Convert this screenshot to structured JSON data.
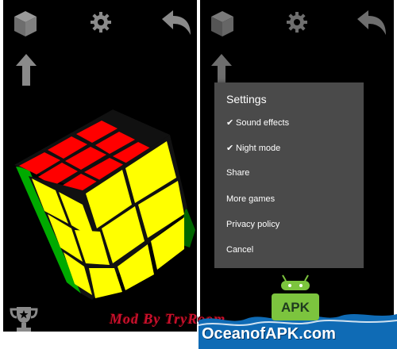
{
  "settings_menu": {
    "title": "Settings",
    "items": [
      {
        "label": "Sound effects",
        "checked": true
      },
      {
        "label": "Night mode",
        "checked": true
      },
      {
        "label": "Share",
        "checked": false
      },
      {
        "label": "More games",
        "checked": false
      },
      {
        "label": "Privacy policy",
        "checked": false
      },
      {
        "label": "Cancel",
        "checked": false
      }
    ],
    "check_mark": "✔"
  },
  "watermark": {
    "text": "Mod By TryRoom"
  },
  "brand": {
    "name": "OceanofAPK.com",
    "badge_text": "APK"
  },
  "colors": {
    "background": "#000000",
    "icon_gray": "#8a8a8a",
    "cube_red": "#ff0000",
    "cube_yellow": "#ffff00",
    "cube_green": "#00aa00",
    "menu_bg": "#4a4a4a",
    "android_green": "#7cc43e",
    "ocean_blue": "#0f6bb5"
  },
  "icons": {
    "left": [
      "cube-icon",
      "gear-icon",
      "undo-icon",
      "up-arrow-icon",
      "trophy-icon"
    ],
    "right": [
      "cube-icon",
      "gear-icon",
      "undo-icon",
      "up-arrow-icon"
    ]
  }
}
